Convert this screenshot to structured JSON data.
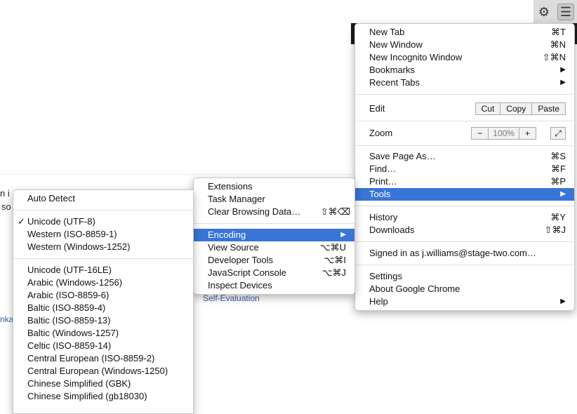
{
  "toolbar": {
    "settings_icon": "gear-icon",
    "menu_icon": "hamburger-icon"
  },
  "background": {
    "fragment1": "n i",
    "fragment2": "so",
    "link": "Self-Evaluation",
    "fragment3": "nka"
  },
  "main_menu": {
    "new_tab": {
      "label": "New Tab",
      "shortcut": "⌘T"
    },
    "new_window": {
      "label": "New Window",
      "shortcut": "⌘N"
    },
    "incognito": {
      "label": "New Incognito Window",
      "shortcut": "⇧⌘N"
    },
    "bookmarks": {
      "label": "Bookmarks"
    },
    "recent_tabs": {
      "label": "Recent Tabs"
    },
    "edit": {
      "label": "Edit",
      "cut": "Cut",
      "copy": "Copy",
      "paste": "Paste"
    },
    "zoom": {
      "label": "Zoom",
      "minus": "−",
      "value": "100%",
      "plus": "+"
    },
    "save_page": {
      "label": "Save Page As…",
      "shortcut": "⌘S"
    },
    "find": {
      "label": "Find…",
      "shortcut": "⌘F"
    },
    "print": {
      "label": "Print…",
      "shortcut": "⌘P"
    },
    "tools": {
      "label": "Tools"
    },
    "history": {
      "label": "History",
      "shortcut": "⌘Y"
    },
    "downloads": {
      "label": "Downloads",
      "shortcut": "⇧⌘J"
    },
    "signed_in": {
      "label": "Signed in as j.williams@stage-two.com…"
    },
    "settings": {
      "label": "Settings"
    },
    "about": {
      "label": "About Google Chrome"
    },
    "help": {
      "label": "Help"
    }
  },
  "tools_menu": {
    "extensions": {
      "label": "Extensions"
    },
    "task_manager": {
      "label": "Task Manager"
    },
    "clear_data": {
      "label": "Clear Browsing Data…",
      "shortcut": "⇧⌘⌫"
    },
    "encoding": {
      "label": "Encoding"
    },
    "view_source": {
      "label": "View Source",
      "shortcut": "⌥⌘U"
    },
    "dev_tools": {
      "label": "Developer Tools",
      "shortcut": "⌥⌘I"
    },
    "js_console": {
      "label": "JavaScript Console",
      "shortcut": "⌥⌘J"
    },
    "inspect_devices": {
      "label": "Inspect Devices"
    }
  },
  "encoding_menu": {
    "auto_detect": "Auto Detect",
    "checkmark": "✓",
    "group1": [
      "Unicode (UTF-8)",
      "Western (ISO-8859-1)",
      "Western (Windows-1252)"
    ],
    "group2": [
      "Unicode (UTF-16LE)",
      "Arabic (Windows-1256)",
      "Arabic (ISO-8859-6)",
      "Baltic (ISO-8859-4)",
      "Baltic (ISO-8859-13)",
      "Baltic (Windows-1257)",
      "Celtic (ISO-8859-14)",
      "Central European (ISO-8859-2)",
      "Central European (Windows-1250)",
      "Chinese Simplified (GBK)",
      "Chinese Simplified (gb18030)"
    ]
  }
}
